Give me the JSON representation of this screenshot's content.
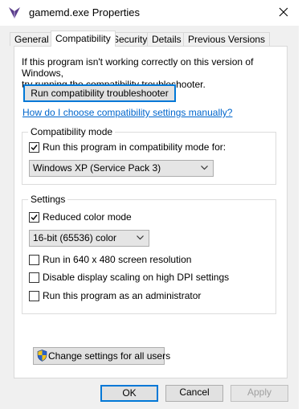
{
  "window": {
    "title": "gamemd.exe Properties"
  },
  "tabs": [
    {
      "label": "General"
    },
    {
      "label": "Compatibility"
    },
    {
      "label": "Security"
    },
    {
      "label": "Details"
    },
    {
      "label": "Previous Versions"
    }
  ],
  "intro": {
    "line1": "If this program isn't working correctly on this version of Windows,",
    "line2": "try running the compatibility troubleshooter."
  },
  "troubleshooter_button": "Run compatibility troubleshooter",
  "help_link": "How do I choose compatibility settings manually?",
  "compat_mode": {
    "group_label": "Compatibility mode",
    "checkbox_label": "Run this program in compatibility mode for:",
    "checked": true,
    "selected_os": "Windows XP (Service Pack 3)"
  },
  "settings": {
    "group_label": "Settings",
    "reduced_color": {
      "label": "Reduced color mode",
      "checked": true
    },
    "color_depth": "16-bit (65536) color",
    "res_640": {
      "label": "Run in 640 x 480 screen resolution",
      "checked": false
    },
    "dpi": {
      "label": "Disable display scaling on high DPI settings",
      "checked": false
    },
    "admin": {
      "label": "Run this program as an administrator",
      "checked": false
    }
  },
  "change_all_users_button": "Change settings for all users",
  "footer": {
    "ok": "OK",
    "cancel": "Cancel",
    "apply": "Apply"
  }
}
